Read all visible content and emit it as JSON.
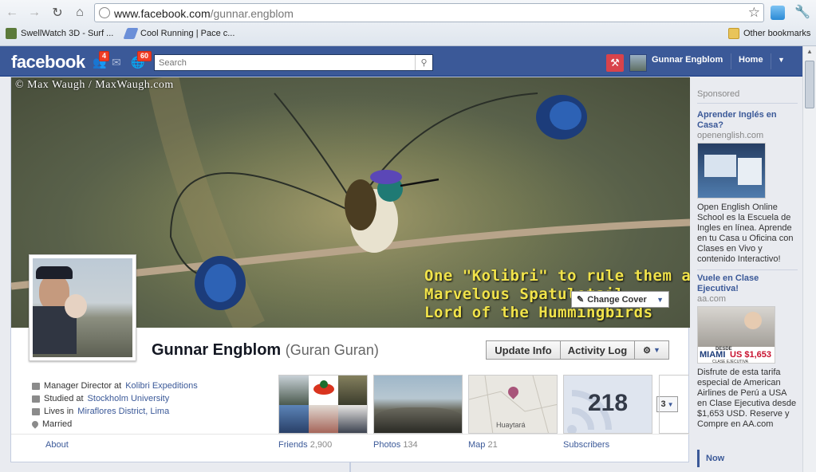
{
  "browser": {
    "url_host": "www.facebook.com",
    "url_path": "/gunnar.engblom",
    "bookmarks": [
      {
        "label": "SwellWatch 3D - Surf ..."
      },
      {
        "label": "Cool Running | Pace c..."
      }
    ],
    "other_bookmarks": "Other bookmarks"
  },
  "fb": {
    "logo": "facebook",
    "friend_requests_count": "4",
    "notifications_count": "60",
    "search_placeholder": "Search",
    "user_name": "Gunnar Engblom",
    "home_label": "Home"
  },
  "cover": {
    "credit": "© Max Waugh / MaxWaugh.com",
    "caption_line1": "One \"Kolibri\" to rule them all.",
    "caption_line2": "Marvelous Spatuletail",
    "caption_line3": "Lord of the Hummingbirds",
    "change_cover_label": "Change Cover"
  },
  "profile": {
    "name": "Gunnar Engblom",
    "alt_name": "(Guran Guran)",
    "update_info": "Update Info",
    "activity_log": "Activity Log",
    "info": [
      {
        "prefix": "Manager Director at ",
        "link": "Kolibri Expeditions"
      },
      {
        "prefix": "Studied at ",
        "link": "Stockholm University"
      },
      {
        "prefix": "Lives in ",
        "link": "Miraflores District, Lima"
      },
      {
        "prefix": "Married",
        "link": ""
      }
    ],
    "about_label": "About",
    "friends_label": "Friends",
    "friends_count": "2,900",
    "photos_label": "Photos",
    "photos_count": "134",
    "map_label": "Map",
    "map_count": "21",
    "map_place": "Huaytará",
    "subscribers_label": "Subscribers",
    "subscribers_count": "218",
    "more_count": "3"
  },
  "sidebar": {
    "sponsored": "Sponsored",
    "ads": [
      {
        "title": "Aprender Inglés en Casa?",
        "host": "openenglish.com",
        "text": "Open English Online School es la Escuela de Ingles en línea. Aprende en tu Casa u Oficina con Clases en Vivo y contenido Interactivo!"
      },
      {
        "title": "Vuele en Clase Ejecutiva!",
        "host": "aa.com",
        "img_top": "DESDE",
        "img_city": "MIAMI",
        "img_price": "US $1,653",
        "img_class": "CLASE EJECUTIVA",
        "text": "Disfrute de esta tarifa especial de American Airlines de Perú a USA en Clase Ejecutiva desde $1,653 USD. Reserve y Compre en AA.com"
      }
    ],
    "now_label": "Now"
  }
}
